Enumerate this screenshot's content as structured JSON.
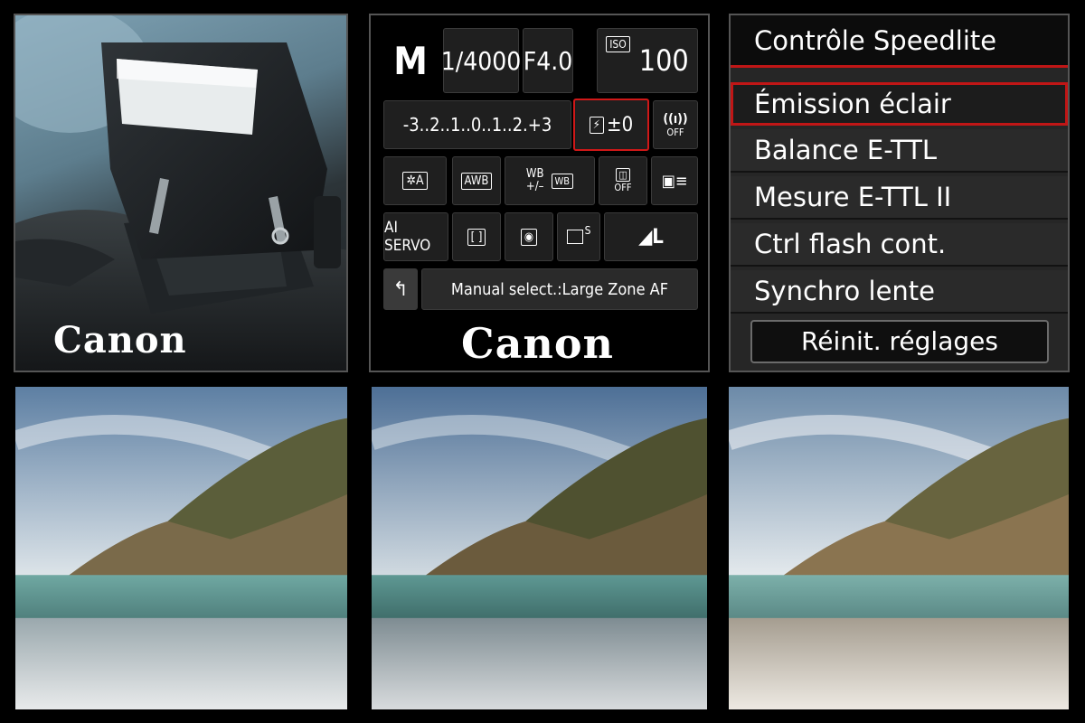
{
  "camera_photo": {
    "logo": "Canon"
  },
  "quick_control": {
    "mode": "M",
    "shutter": "1/4000",
    "aperture": "F4.0",
    "iso_label": "ISO",
    "iso_value": "100",
    "exposure_scale": "-3..2..1..0..1..2.+3",
    "flash_comp": "±0",
    "wireless_label": "OFF",
    "picture_style": "A",
    "white_balance": "AWB",
    "wb_shift_top": "WB",
    "wb_shift_bottom": "+/–",
    "alo_label": "OFF",
    "af_mode": "AI SERVO",
    "drive": "S",
    "quality": "L",
    "af_area_label": "Manual select.:Large Zone AF",
    "logo": "Canon"
  },
  "speedlite_menu": {
    "title": "Contrôle Speedlite",
    "items": [
      {
        "label": "Émission éclair"
      },
      {
        "label": "Balance E-TTL"
      },
      {
        "label": "Mesure E-TTL II"
      },
      {
        "label": "Ctrl flash cont."
      },
      {
        "label": "Synchro lente"
      }
    ],
    "selected_index": 0,
    "reset_label": "Réinit. réglages"
  },
  "colors": {
    "accent_red": "#c01616",
    "panel_bg": "#262626"
  }
}
